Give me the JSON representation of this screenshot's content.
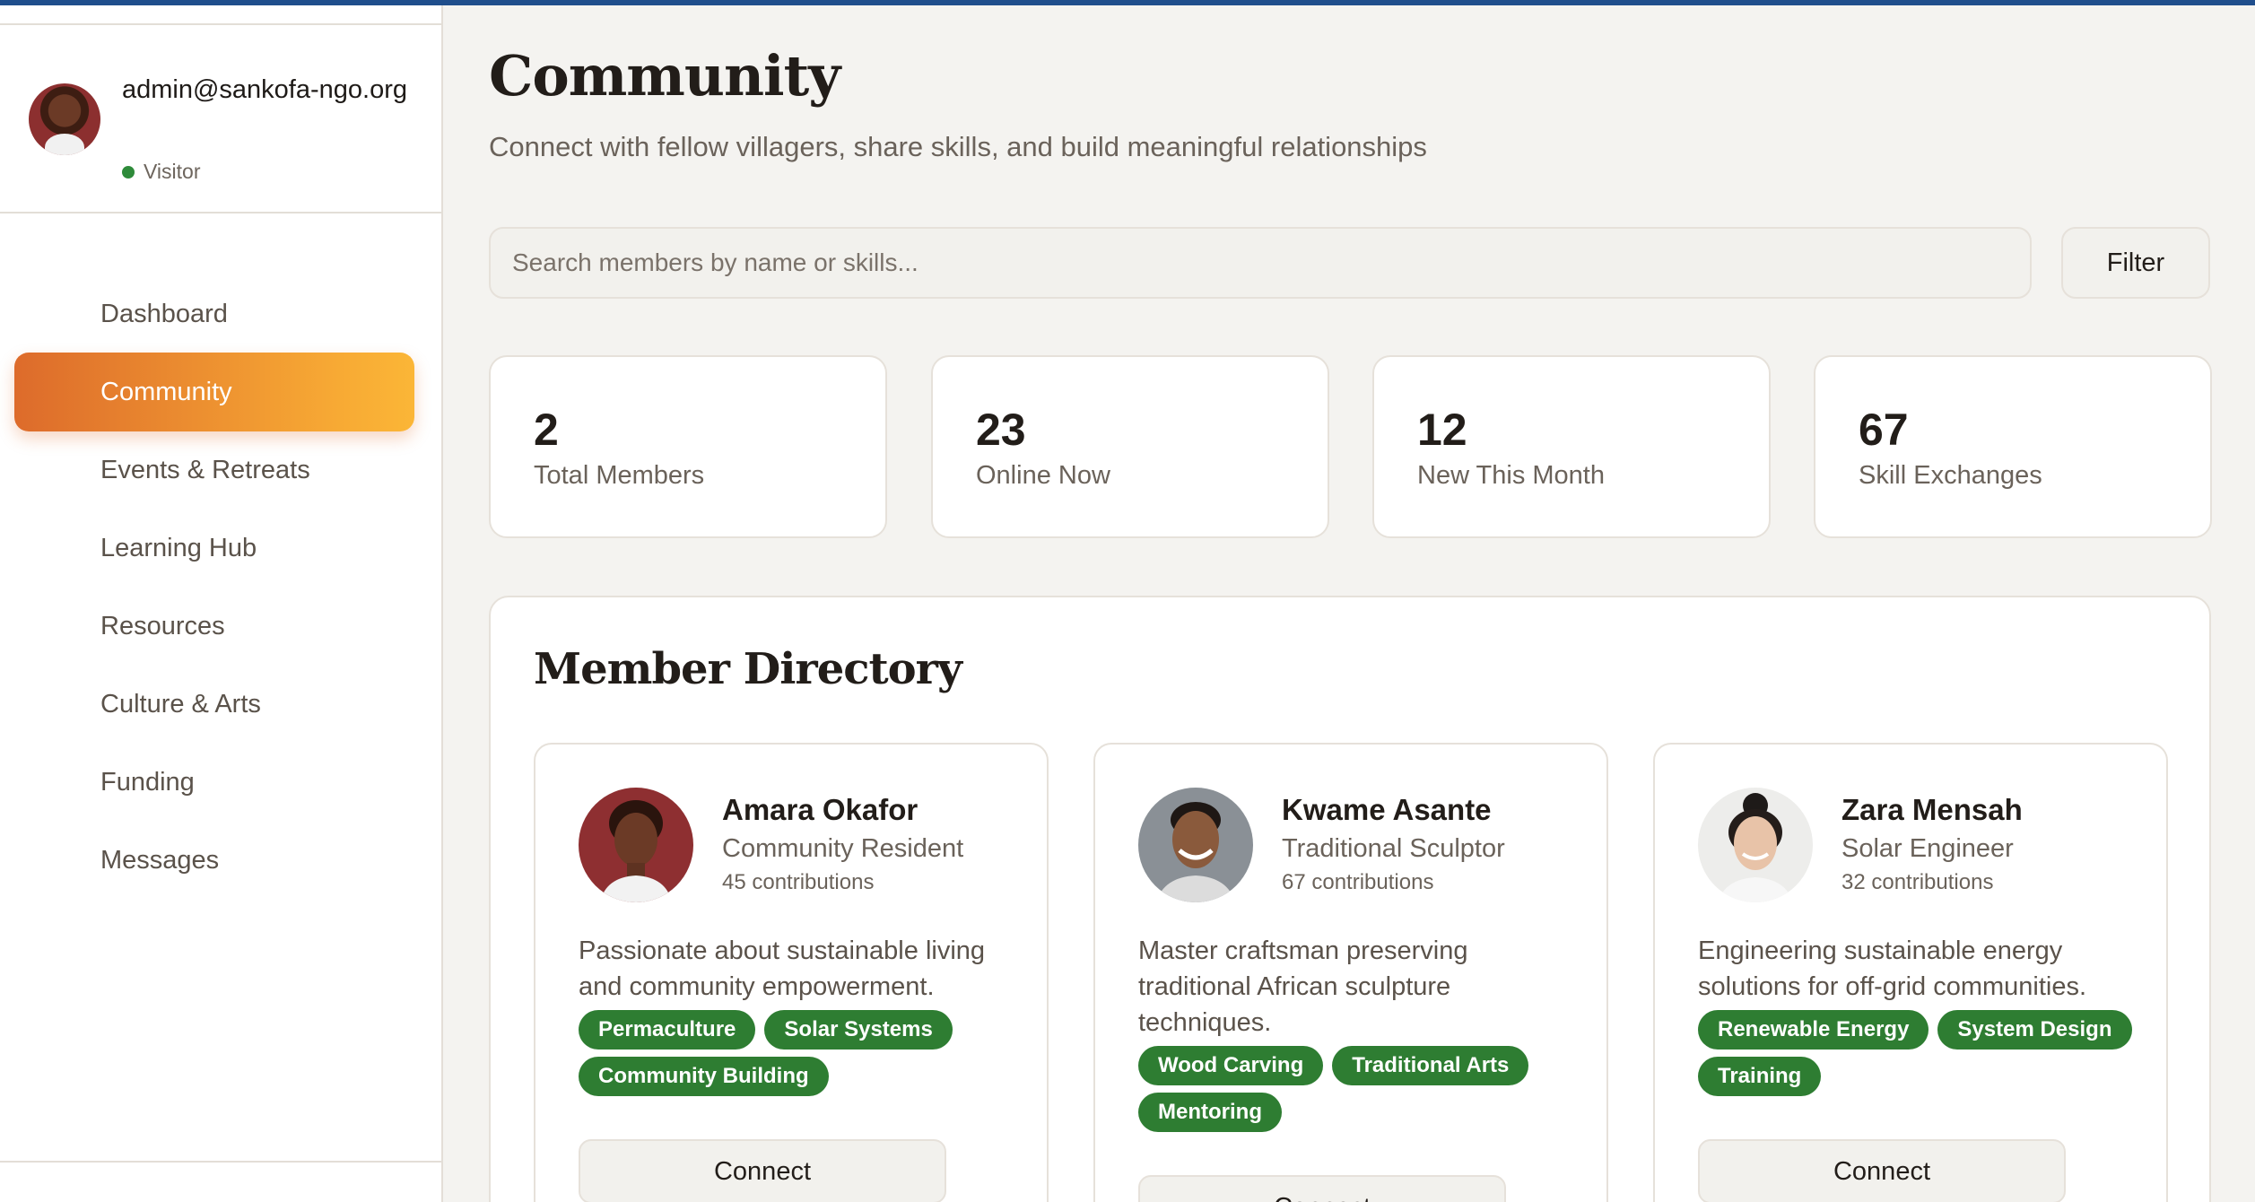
{
  "sidebar": {
    "user_email": "admin@sankofa-ngo.org",
    "user_status": "Visitor",
    "nav": [
      {
        "label": "Dashboard"
      },
      {
        "label": "Community"
      },
      {
        "label": "Events & Retreats"
      },
      {
        "label": "Learning Hub"
      },
      {
        "label": "Resources"
      },
      {
        "label": "Culture & Arts"
      },
      {
        "label": "Funding"
      },
      {
        "label": "Messages"
      }
    ],
    "active_item": "Community"
  },
  "header": {
    "title": "Community",
    "subtitle": "Connect with fellow villagers, share skills, and build meaningful relationships"
  },
  "search": {
    "placeholder": "Search members by name or skills...",
    "value": "",
    "filter_label": "Filter"
  },
  "stats": [
    {
      "value": "2",
      "label": "Total Members"
    },
    {
      "value": "23",
      "label": "Online Now"
    },
    {
      "value": "12",
      "label": "New This Month"
    },
    {
      "value": "67",
      "label": "Skill Exchanges"
    }
  ],
  "directory": {
    "title": "Member Directory",
    "members": [
      {
        "name": "Amara Okafor",
        "role": "Community Resident",
        "contributions": "45 contributions",
        "bio": "Passionate about sustainable living and community empowerment.",
        "tags": [
          "Permaculture",
          "Solar Systems",
          "Community Building"
        ],
        "connect_label": "Connect"
      },
      {
        "name": "Kwame Asante",
        "role": "Traditional Sculptor",
        "contributions": "67 contributions",
        "bio": "Master craftsman preserving traditional African sculpture techniques.",
        "tags": [
          "Wood Carving",
          "Traditional Arts",
          "Mentoring"
        ],
        "connect_label": "Connect"
      },
      {
        "name": "Zara Mensah",
        "role": "Solar Engineer",
        "contributions": "32 contributions",
        "bio": "Engineering sustainable energy solutions for off-grid communities.",
        "tags": [
          "Renewable Energy",
          "System Design",
          "Training"
        ],
        "connect_label": "Connect"
      }
    ]
  },
  "colors": {
    "accent_gradient_start": "#dd6b2b",
    "accent_gradient_end": "#fbb637",
    "tag_green": "#2e7d32",
    "online_dot": "#2e8b3a",
    "top_bar": "#1f4e8c"
  }
}
